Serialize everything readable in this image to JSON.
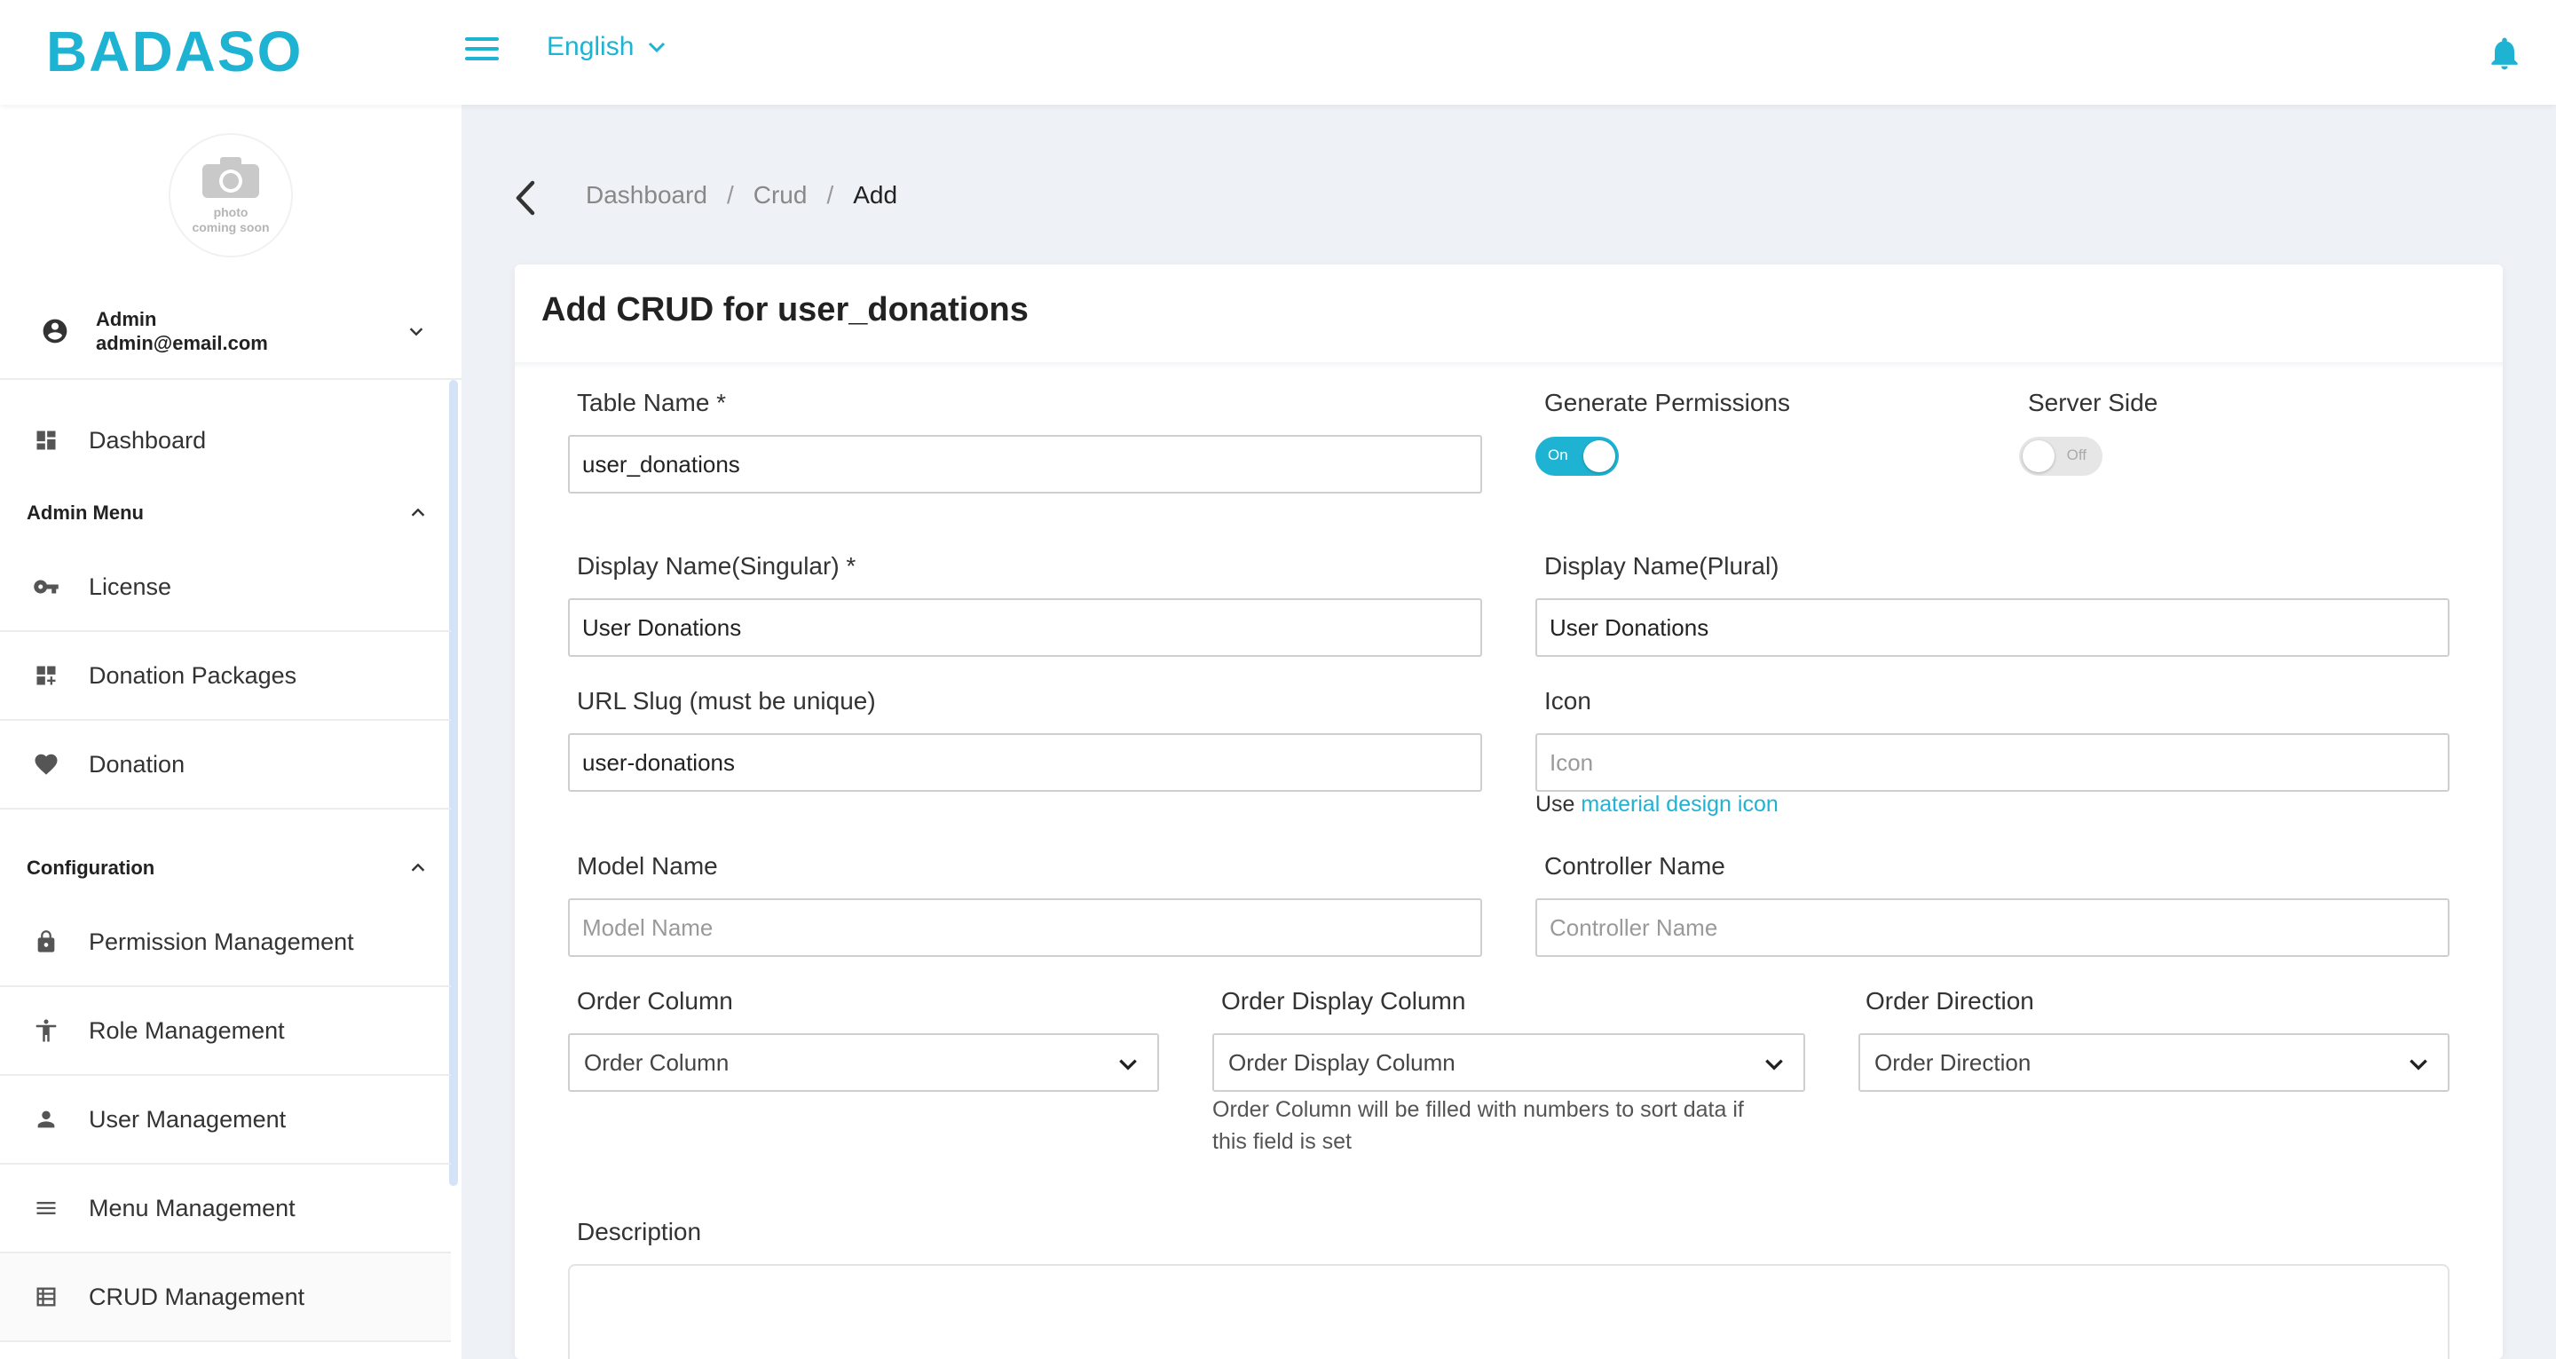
{
  "app": {
    "logo_text": "BADASO",
    "brand_color": "#1fb3d3"
  },
  "header": {
    "language": "English"
  },
  "sidebar": {
    "avatar_text_1": "photo",
    "avatar_text_2": "coming soon",
    "user_name": "Admin",
    "user_email": "admin@email.com",
    "items": [
      {
        "label": "Dashboard",
        "icon": "dashboard-icon"
      }
    ],
    "admin_menu": {
      "title": "Admin Menu",
      "items": [
        {
          "label": "License",
          "icon": "key-icon"
        },
        {
          "label": "Donation Packages",
          "icon": "widgets-icon"
        },
        {
          "label": "Donation",
          "icon": "heart-icon"
        }
      ]
    },
    "configuration": {
      "title": "Configuration",
      "items": [
        {
          "label": "Permission Management",
          "icon": "lock-icon"
        },
        {
          "label": "Role Management",
          "icon": "accessibility-icon"
        },
        {
          "label": "User Management",
          "icon": "person-icon"
        },
        {
          "label": "Menu Management",
          "icon": "menu-icon"
        },
        {
          "label": "CRUD Management",
          "icon": "table-icon"
        }
      ]
    }
  },
  "breadcrumb": {
    "items": [
      "Dashboard",
      "Crud",
      "Add"
    ],
    "separator": "/"
  },
  "form": {
    "title": "Add CRUD for user_donations",
    "table_name": {
      "label": "Table Name *",
      "value": "user_donations"
    },
    "generate_permissions": {
      "label": "Generate Permissions",
      "state": "On"
    },
    "server_side": {
      "label": "Server Side",
      "state": "Off"
    },
    "display_singular": {
      "label": "Display Name(Singular) *",
      "value": "User Donations"
    },
    "display_plural": {
      "label": "Display Name(Plural)",
      "value": "User Donations"
    },
    "url_slug": {
      "label": "URL Slug (must be unique)",
      "value": "user-donations"
    },
    "icon": {
      "label": "Icon",
      "placeholder": "Icon",
      "help_prefix": "Use",
      "help_link": "material design icon"
    },
    "model_name": {
      "label": "Model Name",
      "placeholder": "Model Name"
    },
    "controller_name": {
      "label": "Controller Name",
      "placeholder": "Controller Name"
    },
    "order_column": {
      "label": "Order Column",
      "placeholder": "Order Column"
    },
    "order_display_column": {
      "label": "Order Display Column",
      "placeholder": "Order Display Column",
      "hint_1": "Order Column will be filled with numbers to sort data if",
      "hint_2": "this field is set"
    },
    "order_direction": {
      "label": "Order Direction",
      "placeholder": "Order Direction"
    },
    "description": {
      "label": "Description"
    }
  }
}
